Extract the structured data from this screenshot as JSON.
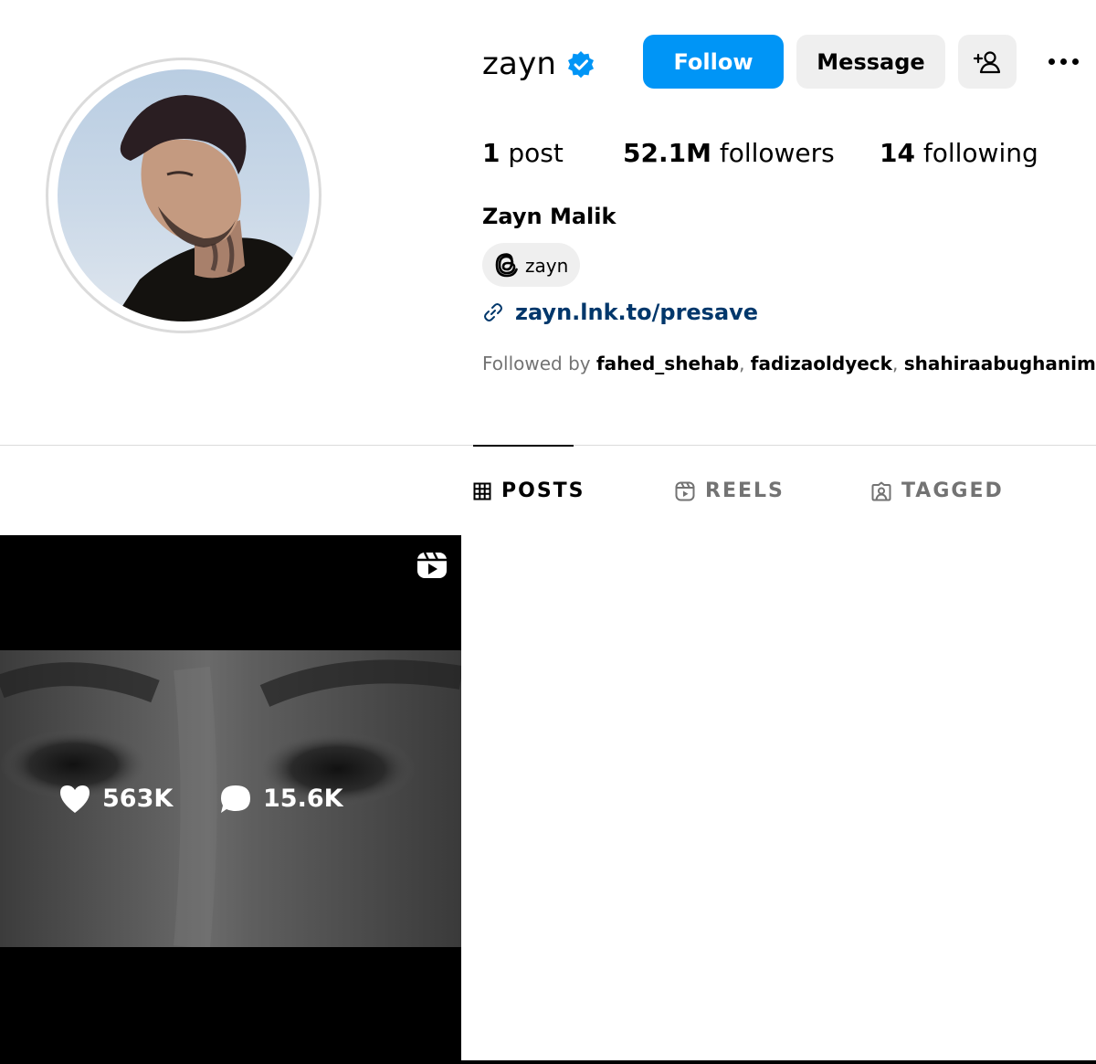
{
  "profile": {
    "username": "zayn",
    "full_name": "Zayn Malik",
    "verified_icon": "verified-badge-icon",
    "threads_handle": "zayn",
    "link": "zayn.lnk.to/presave",
    "followed_by_prefix": "Followed by ",
    "followed_by_users": [
      "fahed_shehab",
      "fadizaoldyeck",
      "shahiraabughanimeh"
    ],
    "followed_by_sep": ", ",
    "followed_by_suffix": " +"
  },
  "actions": {
    "follow_label": "Follow",
    "message_label": "Message",
    "suggest_icon": "add-person-icon",
    "more_icon": "more-options-icon"
  },
  "stats": {
    "posts_count": "1",
    "posts_label": " post",
    "followers_count": "52.1M",
    "followers_label": " followers",
    "following_count": "14",
    "following_label": " following"
  },
  "tabs": [
    {
      "label": "POSTS",
      "icon": "grid-icon",
      "active": true
    },
    {
      "label": "REELS",
      "icon": "reels-icon",
      "active": false
    },
    {
      "label": "TAGGED",
      "icon": "tagged-icon",
      "active": false
    }
  ],
  "post": {
    "likes": "563K",
    "comments": "15.6K",
    "type_icon": "reel-badge-icon"
  },
  "colors": {
    "accent": "#0095f6",
    "button_secondary": "#efefef",
    "link": "#00376b",
    "muted_text": "#737373",
    "divider": "#dbdbdb"
  }
}
